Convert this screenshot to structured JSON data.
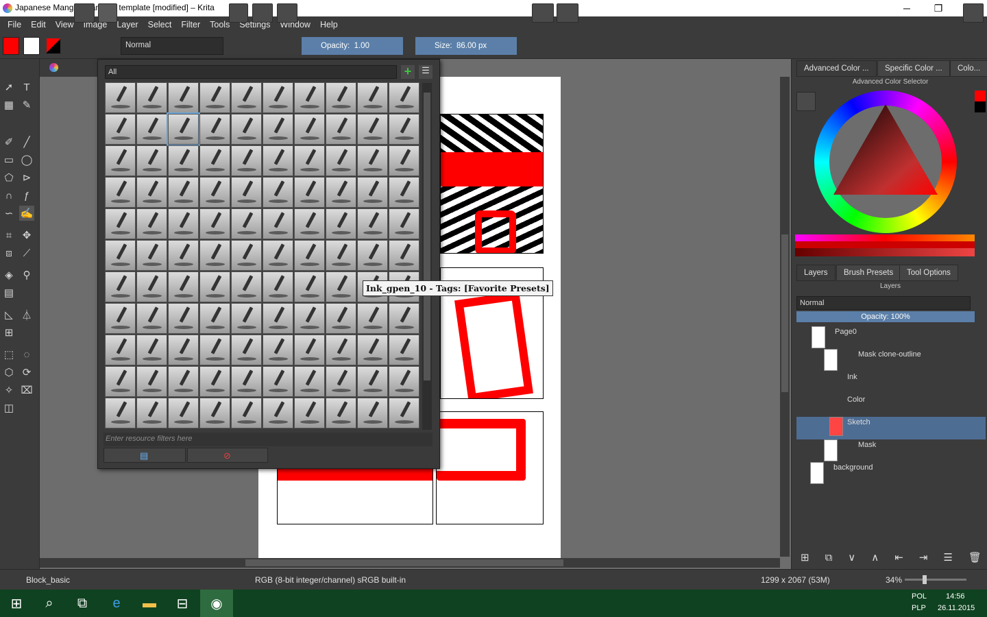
{
  "window": {
    "title": "Japanese Mangas standard template [modified] – Krita",
    "minimize": "─",
    "maximize": "❐",
    "close": "✕"
  },
  "menu": [
    "File",
    "Edit",
    "View",
    "Image",
    "Layer",
    "Select",
    "Filter",
    "Tools",
    "Settings",
    "Window",
    "Help"
  ],
  "toolbar": {
    "blend_mode": "Normal",
    "opacity_label": "Opacity:",
    "opacity_value": "1.00",
    "size_label": "Size:",
    "size_value": "86.00 px"
  },
  "brush_popup": {
    "tag_filter": "All",
    "filter_placeholder": "Enter resource filters here",
    "tooltip": "Ink_gpen_10 - Tags: [Favorite Presets]"
  },
  "dockers": {
    "color_tabs": [
      "Advanced Color ...",
      "Specific Color ...",
      "Colo..."
    ],
    "advanced_color_title": "Advanced Color Selector",
    "layer_tabs": [
      "Layers",
      "Brush Presets",
      "Tool Options"
    ],
    "layers_title": "Layers",
    "layers_blend": "Normal",
    "layers_opacity": "Opacity:  100%",
    "layers": [
      {
        "name": "Page0"
      },
      {
        "name": "Mask clone-outline"
      },
      {
        "name": "Ink"
      },
      {
        "name": "Color"
      },
      {
        "name": "Sketch"
      },
      {
        "name": "Mask"
      },
      {
        "name": "background"
      }
    ]
  },
  "statusbar": {
    "preset": "Block_basic",
    "colorspace": "RGB (8-bit integer/channel)  sRGB built-in",
    "dimensions": "1299 x 2067 (53M)",
    "zoom": "34%"
  },
  "taskbar": {
    "lang": "POL",
    "lang2": "PLP",
    "time": "14:56",
    "date": "26.11.2015"
  },
  "colors": {
    "accent": "#5b7fa8",
    "foreground": "#ff0000",
    "background": "#ffffff"
  }
}
